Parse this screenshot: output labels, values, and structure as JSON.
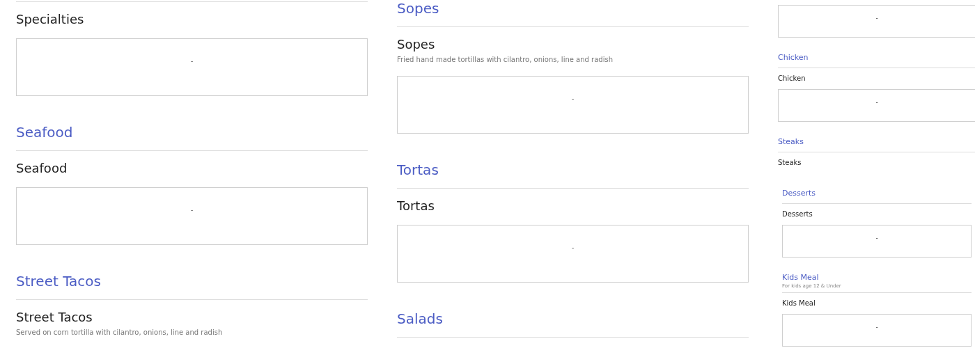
{
  "columns": [
    {
      "blocks": [
        {
          "kind": "rule"
        },
        {
          "kind": "item",
          "title": "Specialties"
        },
        {
          "kind": "box",
          "mark": "-"
        },
        {
          "kind": "heading",
          "title": "Seafood"
        },
        {
          "kind": "item",
          "title": "Seafood"
        },
        {
          "kind": "box",
          "mark": "-"
        },
        {
          "kind": "heading",
          "title": "Street Tacos"
        },
        {
          "kind": "item",
          "title": "Street Tacos",
          "description": "Served on corn tortilla with cilantro, onions, line and radish"
        }
      ]
    },
    {
      "blocks": [
        {
          "kind": "heading",
          "title": "Sopes"
        },
        {
          "kind": "item",
          "title": "Sopes",
          "description": "Fried hand made tortillas with cilantro, onions, line and radish"
        },
        {
          "kind": "box",
          "mark": "-"
        },
        {
          "kind": "heading",
          "title": "Tortas"
        },
        {
          "kind": "item",
          "title": "Tortas"
        },
        {
          "kind": "box",
          "mark": "-"
        },
        {
          "kind": "heading",
          "title": "Salads"
        }
      ]
    },
    {
      "blocks": [
        {
          "kind": "box",
          "mark": "-"
        },
        {
          "kind": "heading",
          "title": "Chicken"
        },
        {
          "kind": "item",
          "title": "Chicken"
        },
        {
          "kind": "box",
          "mark": "-"
        },
        {
          "kind": "heading",
          "title": "Steaks"
        },
        {
          "kind": "item",
          "title": "Steaks"
        },
        {
          "kind": "group",
          "blocks": [
            {
              "kind": "heading",
              "title": "Desserts"
            },
            {
              "kind": "item",
              "title": "Desserts"
            },
            {
              "kind": "box",
              "mark": "-"
            },
            {
              "kind": "heading",
              "title": "Kids Meal",
              "subtitle": "For kids age 12 & Under"
            },
            {
              "kind": "item",
              "title": "Kids Meal"
            },
            {
              "kind": "box",
              "mark": "-"
            }
          ]
        }
      ]
    }
  ]
}
